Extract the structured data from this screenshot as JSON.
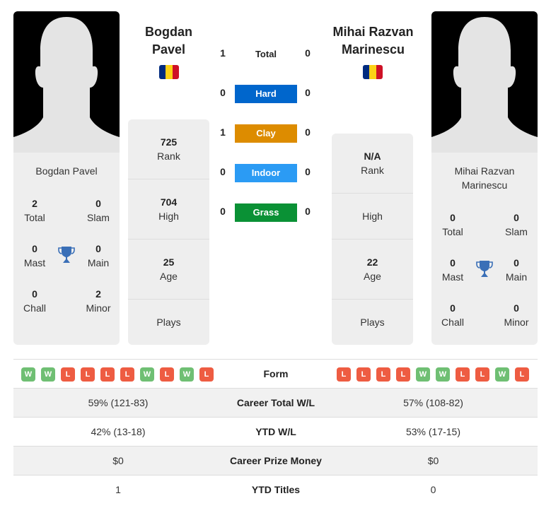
{
  "player1": {
    "name": "Bogdan Pavel",
    "head_name_line1": "Bogdan",
    "head_name_line2": "Pavel",
    "flag": "romania-flag",
    "card_name": "Bogdan Pavel",
    "titles": {
      "total": {
        "value": "2",
        "label": "Total"
      },
      "slam": {
        "value": "0",
        "label": "Slam"
      },
      "mast": {
        "value": "0",
        "label": "Mast"
      },
      "main": {
        "value": "0",
        "label": "Main"
      },
      "chall": {
        "value": "0",
        "label": "Chall"
      },
      "minor": {
        "value": "2",
        "label": "Minor"
      }
    },
    "stats": {
      "rank": {
        "value": "725",
        "label": "Rank"
      },
      "high": {
        "value": "704",
        "label": "High"
      },
      "age": {
        "value": "25",
        "label": "Age"
      },
      "plays": {
        "value": "",
        "label": "Plays"
      }
    },
    "form": [
      "W",
      "W",
      "L",
      "L",
      "L",
      "L",
      "W",
      "L",
      "W",
      "L"
    ]
  },
  "player2": {
    "name": "Mihai Razvan Marinescu",
    "head_name_line1": "Mihai Razvan",
    "head_name_line2": "Marinescu",
    "flag": "romania-flag",
    "card_name_line1": "Mihai Razvan",
    "card_name_line2": "Marinescu",
    "titles": {
      "total": {
        "value": "0",
        "label": "Total"
      },
      "slam": {
        "value": "0",
        "label": "Slam"
      },
      "mast": {
        "value": "0",
        "label": "Mast"
      },
      "main": {
        "value": "0",
        "label": "Main"
      },
      "chall": {
        "value": "0",
        "label": "Chall"
      },
      "minor": {
        "value": "0",
        "label": "Minor"
      }
    },
    "stats": {
      "rank": {
        "value": "N/A",
        "label": "Rank"
      },
      "high": {
        "value": "",
        "label": "High"
      },
      "age": {
        "value": "22",
        "label": "Age"
      },
      "plays": {
        "value": "",
        "label": "Plays"
      }
    },
    "form": [
      "L",
      "L",
      "L",
      "L",
      "W",
      "W",
      "L",
      "L",
      "W",
      "L"
    ]
  },
  "flag_colors": [
    "#002B7F",
    "#FCD116",
    "#CE1126"
  ],
  "h2h": [
    {
      "label": "Total",
      "left": "1",
      "right": "0",
      "color": ""
    },
    {
      "label": "Hard",
      "left": "0",
      "right": "0",
      "color": "#0066CC"
    },
    {
      "label": "Clay",
      "left": "1",
      "right": "0",
      "color": "#DD8C00"
    },
    {
      "label": "Indoor",
      "left": "0",
      "right": "0",
      "color": "#2B9BF4"
    },
    {
      "label": "Grass",
      "left": "0",
      "right": "0",
      "color": "#0A9135"
    }
  ],
  "table": {
    "form_label": "Form",
    "rows": [
      {
        "label": "Career Total W/L",
        "left": "59% (121-83)",
        "right": "57% (108-82)"
      },
      {
        "label": "YTD W/L",
        "left": "42% (13-18)",
        "right": "53% (17-15)"
      },
      {
        "label": "Career Prize Money",
        "left": "$0",
        "right": "$0"
      },
      {
        "label": "YTD Titles",
        "left": "1",
        "right": "0"
      }
    ]
  }
}
